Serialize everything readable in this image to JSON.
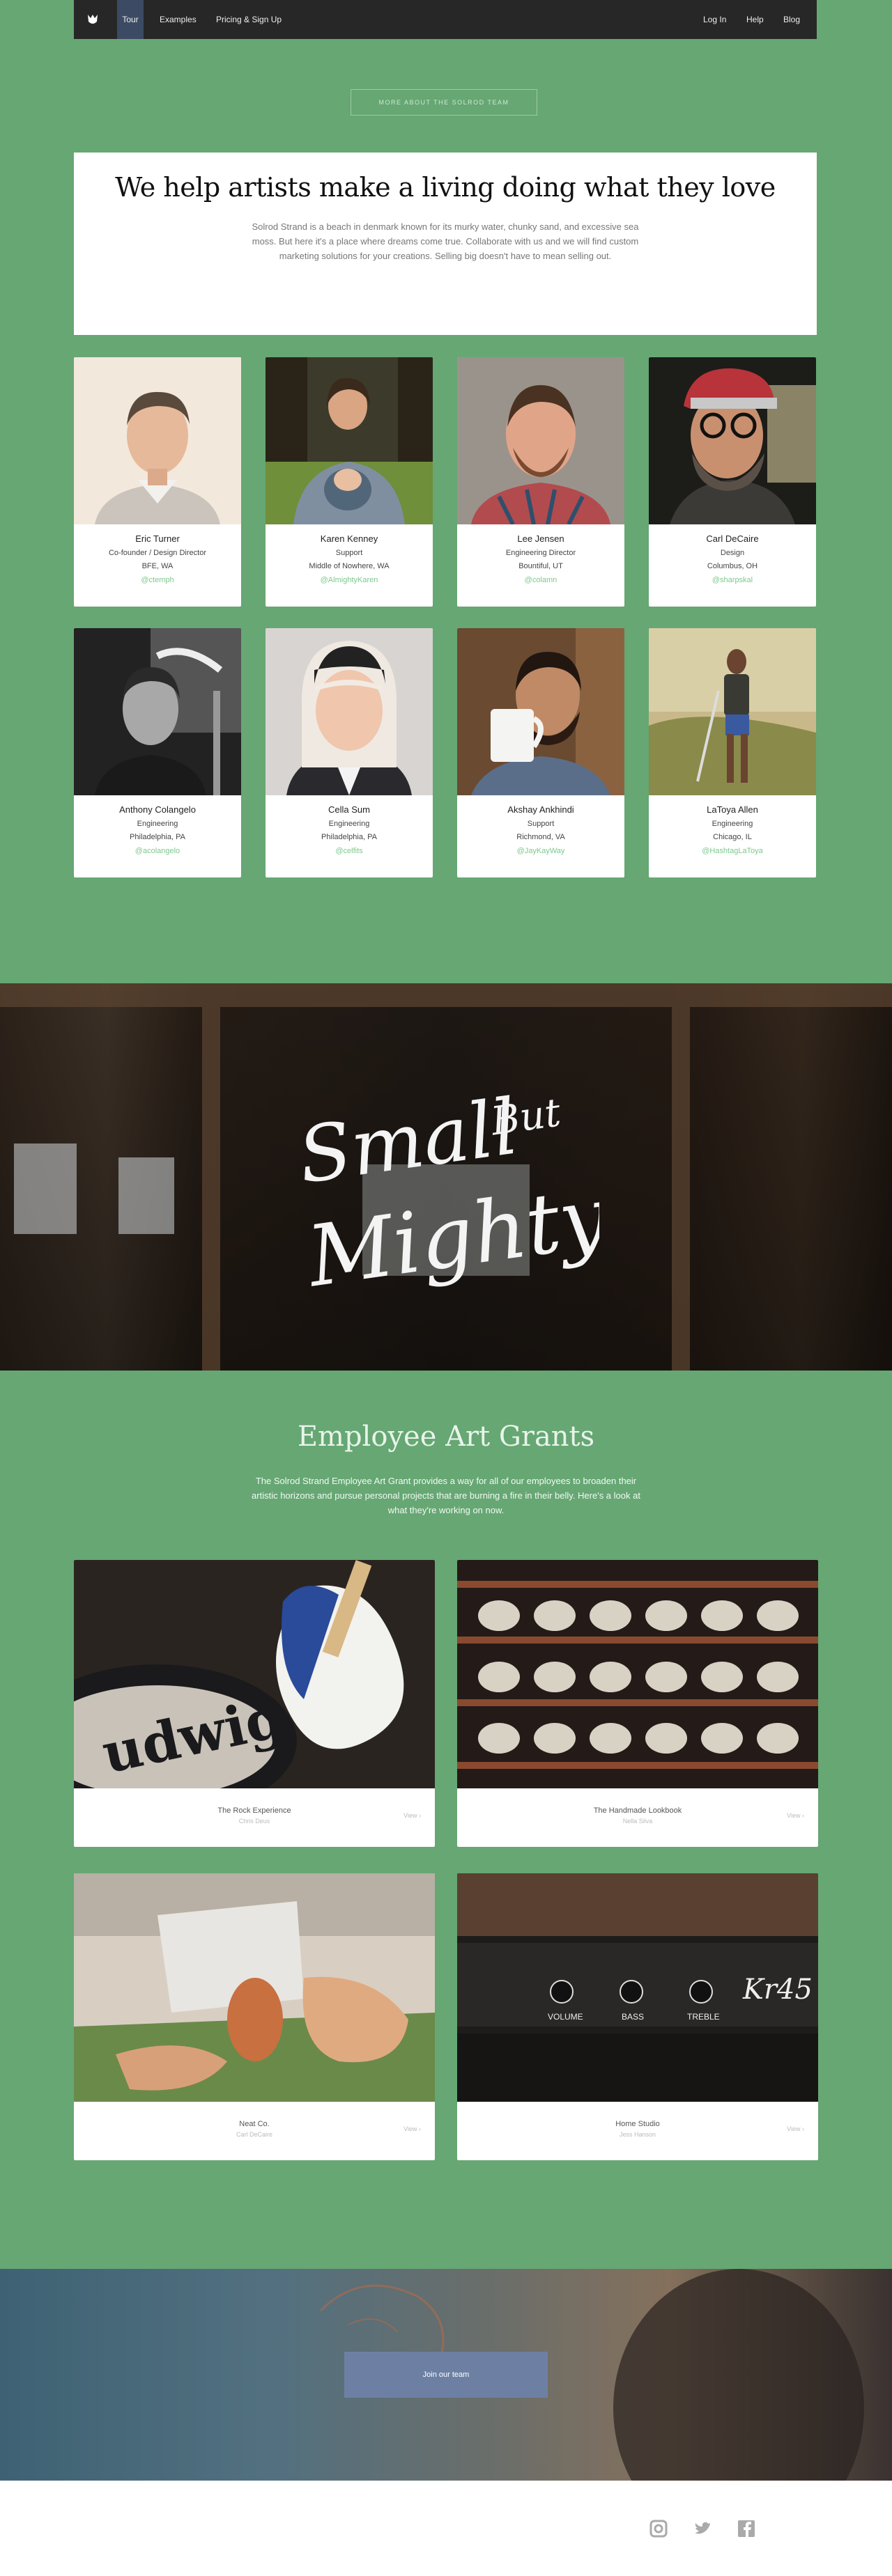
{
  "nav": {
    "logo": "solrod-logo",
    "items": [
      {
        "label": "Tour",
        "active": true
      },
      {
        "label": "Examples"
      },
      {
        "label": "Pricing & Sign Up"
      },
      {
        "label": "Log In"
      },
      {
        "label": "Help"
      },
      {
        "label": "Blog"
      }
    ]
  },
  "team": {
    "more_button": "MORE ABOUT THE SOLROD TEAM",
    "headline": "We help artists make a living doing what they love",
    "intro": "Solrod Strand is a beach in denmark known for its murky water, chunky sand, and excessive sea moss. But here it's a place where dreams come true. Collaborate with us and we will find custom marketing solutions for your creations. Selling big doesn't have to mean selling out.",
    "members": [
      {
        "name": "Eric Turner",
        "role": "Co-founder / Design Director",
        "location": "BFE, WA",
        "handle": "@ctemph"
      },
      {
        "name": "Karen Kenney",
        "role": "Support",
        "location": "Middle of Nowhere, WA",
        "handle": "@AlmightyKaren"
      },
      {
        "name": "Lee Jensen",
        "role": "Engineering Director",
        "location": "Bountiful, UT",
        "handle": "@colamn"
      },
      {
        "name": "Carl DeCaire",
        "role": "Design",
        "location": "Columbus, OH",
        "handle": "@sharpskal"
      },
      {
        "name": "Anthony Colangelo",
        "role": "Engineering",
        "location": "Philadelphia, PA",
        "handle": "@acolangelo"
      },
      {
        "name": "Cella Sum",
        "role": "Engineering",
        "location": "Philadelphia, PA",
        "handle": "@celfits"
      },
      {
        "name": "Akshay Ankhindi",
        "role": "Support",
        "location": "Richmond, VA",
        "handle": "@JayKayWay"
      },
      {
        "name": "LaToya Allen",
        "role": "Engineering",
        "location": "Chicago, IL",
        "handle": "@HashtagLaToya"
      }
    ]
  },
  "hero": {
    "line1": "Small",
    "line2": "But",
    "line3": "Mighty"
  },
  "grants": {
    "title": "Employee Art Grants",
    "description": "The Solrod Strand Employee Art Grant provides a way for all of our employees to broaden their artistic horizons and pursue personal projects that are burning a fire in their belly. Here's a look at what they're working on now.",
    "items": [
      {
        "title": "The Rock Experience",
        "author": "Chris Deus",
        "view": "View"
      },
      {
        "title": "The Handmade Lookbook",
        "author": "Nella Silva",
        "view": "View"
      },
      {
        "title": "Neat Co.",
        "author": "Carl DeCaire",
        "view": "View"
      },
      {
        "title": "Home Studio",
        "author": "Jess Hanson",
        "view": "View"
      }
    ]
  },
  "cta": {
    "join_label": "Join our team"
  },
  "footer": {
    "icons": [
      "instagram-icon",
      "twitter-icon",
      "facebook-icon"
    ]
  },
  "colors": {
    "page_green": "#66a773",
    "nav": "#272727",
    "nav_active": "#3c4b63",
    "handle_green": "#7dc88c",
    "join_button": "#6d80a4"
  }
}
